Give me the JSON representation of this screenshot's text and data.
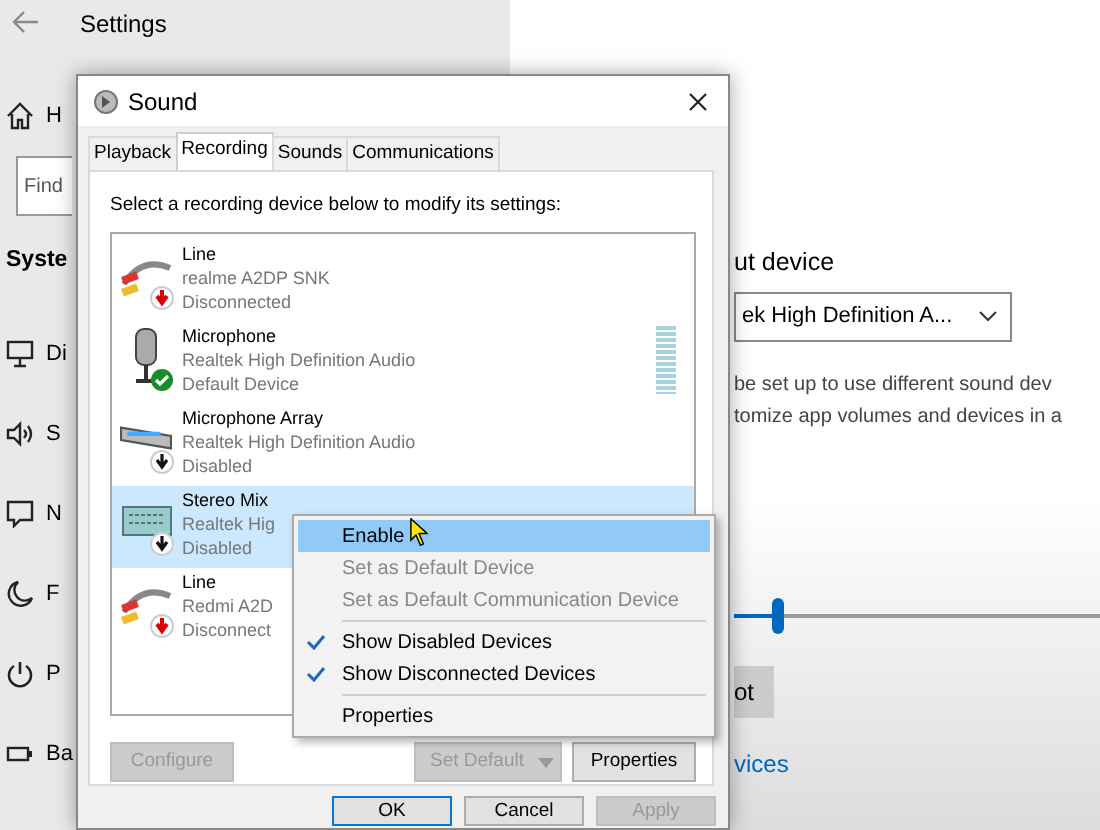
{
  "settings": {
    "title": "Settings",
    "home_label": "H",
    "search": {
      "placeholder": "Find"
    },
    "section_title": "Syste",
    "nav_items": [
      {
        "kind": "display",
        "label": "Di"
      },
      {
        "kind": "speaker",
        "label": "S"
      },
      {
        "kind": "message",
        "label": "N"
      },
      {
        "kind": "moon",
        "label": "F"
      },
      {
        "kind": "power",
        "label": "P"
      },
      {
        "kind": "battery",
        "label": "Ba"
      }
    ],
    "input_heading": "ut device",
    "input_dropdown": {
      "value": "ek High Definition A..."
    },
    "description": [
      "be set up to use different sound dev",
      "tomize app volumes and devices in a"
    ],
    "volume": {
      "level": 0.12
    },
    "button": "ot",
    "link": "vices"
  },
  "dialog": {
    "title": "Sound",
    "tabs": [
      {
        "label": "Playback",
        "selected": false
      },
      {
        "label": "Recording",
        "selected": true
      },
      {
        "label": "Sounds",
        "selected": false
      },
      {
        "label": "Communications",
        "selected": false
      }
    ],
    "instruction": "Select a recording device below to modify its settings:",
    "devices": [
      {
        "kind": "line",
        "name": "Line",
        "driver": "realme A2DP SNK",
        "status": {
          "kind": "disconnected",
          "text": "Disconnected"
        },
        "selected": false
      },
      {
        "kind": "microphone",
        "name": "Microphone",
        "driver": "Realtek High Definition Audio",
        "status": {
          "kind": "default",
          "text": "Default Device"
        },
        "selected": false,
        "level": 0
      },
      {
        "kind": "mic-array",
        "name": "Microphone Array",
        "driver": "Realtek High Definition Audio",
        "status": {
          "kind": "disabled",
          "text": "Disabled"
        },
        "selected": false
      },
      {
        "kind": "board",
        "name": "Stereo Mix",
        "driver": "Realtek Hig",
        "status": {
          "kind": "disabled",
          "text": "Disabled"
        },
        "selected": true
      },
      {
        "kind": "line",
        "name": "Line",
        "driver": "Redmi A2D",
        "status": {
          "kind": "disconnected",
          "text": "Disconnect"
        },
        "selected": false
      }
    ],
    "buttons": [
      {
        "kind": "plain",
        "label": "Configure",
        "disabled": true
      },
      {
        "kind": "split",
        "label": "Set Default",
        "disabled": true
      },
      {
        "kind": "plain",
        "label": "Properties",
        "disabled": false
      }
    ],
    "footer_buttons": [
      {
        "label": "OK",
        "default": true,
        "disabled": false
      },
      {
        "label": "Cancel",
        "default": false,
        "disabled": false
      },
      {
        "label": "Apply",
        "default": false,
        "disabled": true
      }
    ],
    "context_menu": [
      {
        "kind": "item",
        "label": "Enable",
        "highlighted": true,
        "disabled": false,
        "checked": false
      },
      {
        "kind": "item",
        "label": "Set as Default Device",
        "highlighted": false,
        "disabled": true,
        "checked": false
      },
      {
        "kind": "item",
        "label": "Set as Default Communication Device",
        "highlighted": false,
        "disabled": true,
        "checked": false
      },
      {
        "kind": "separator"
      },
      {
        "kind": "item",
        "label": "Show Disabled Devices",
        "highlighted": false,
        "disabled": false,
        "checked": true
      },
      {
        "kind": "item",
        "label": "Show Disconnected Devices",
        "highlighted": false,
        "disabled": false,
        "checked": true
      },
      {
        "kind": "separator"
      },
      {
        "kind": "item",
        "label": "Properties",
        "highlighted": false,
        "disabled": false,
        "checked": false
      }
    ]
  }
}
